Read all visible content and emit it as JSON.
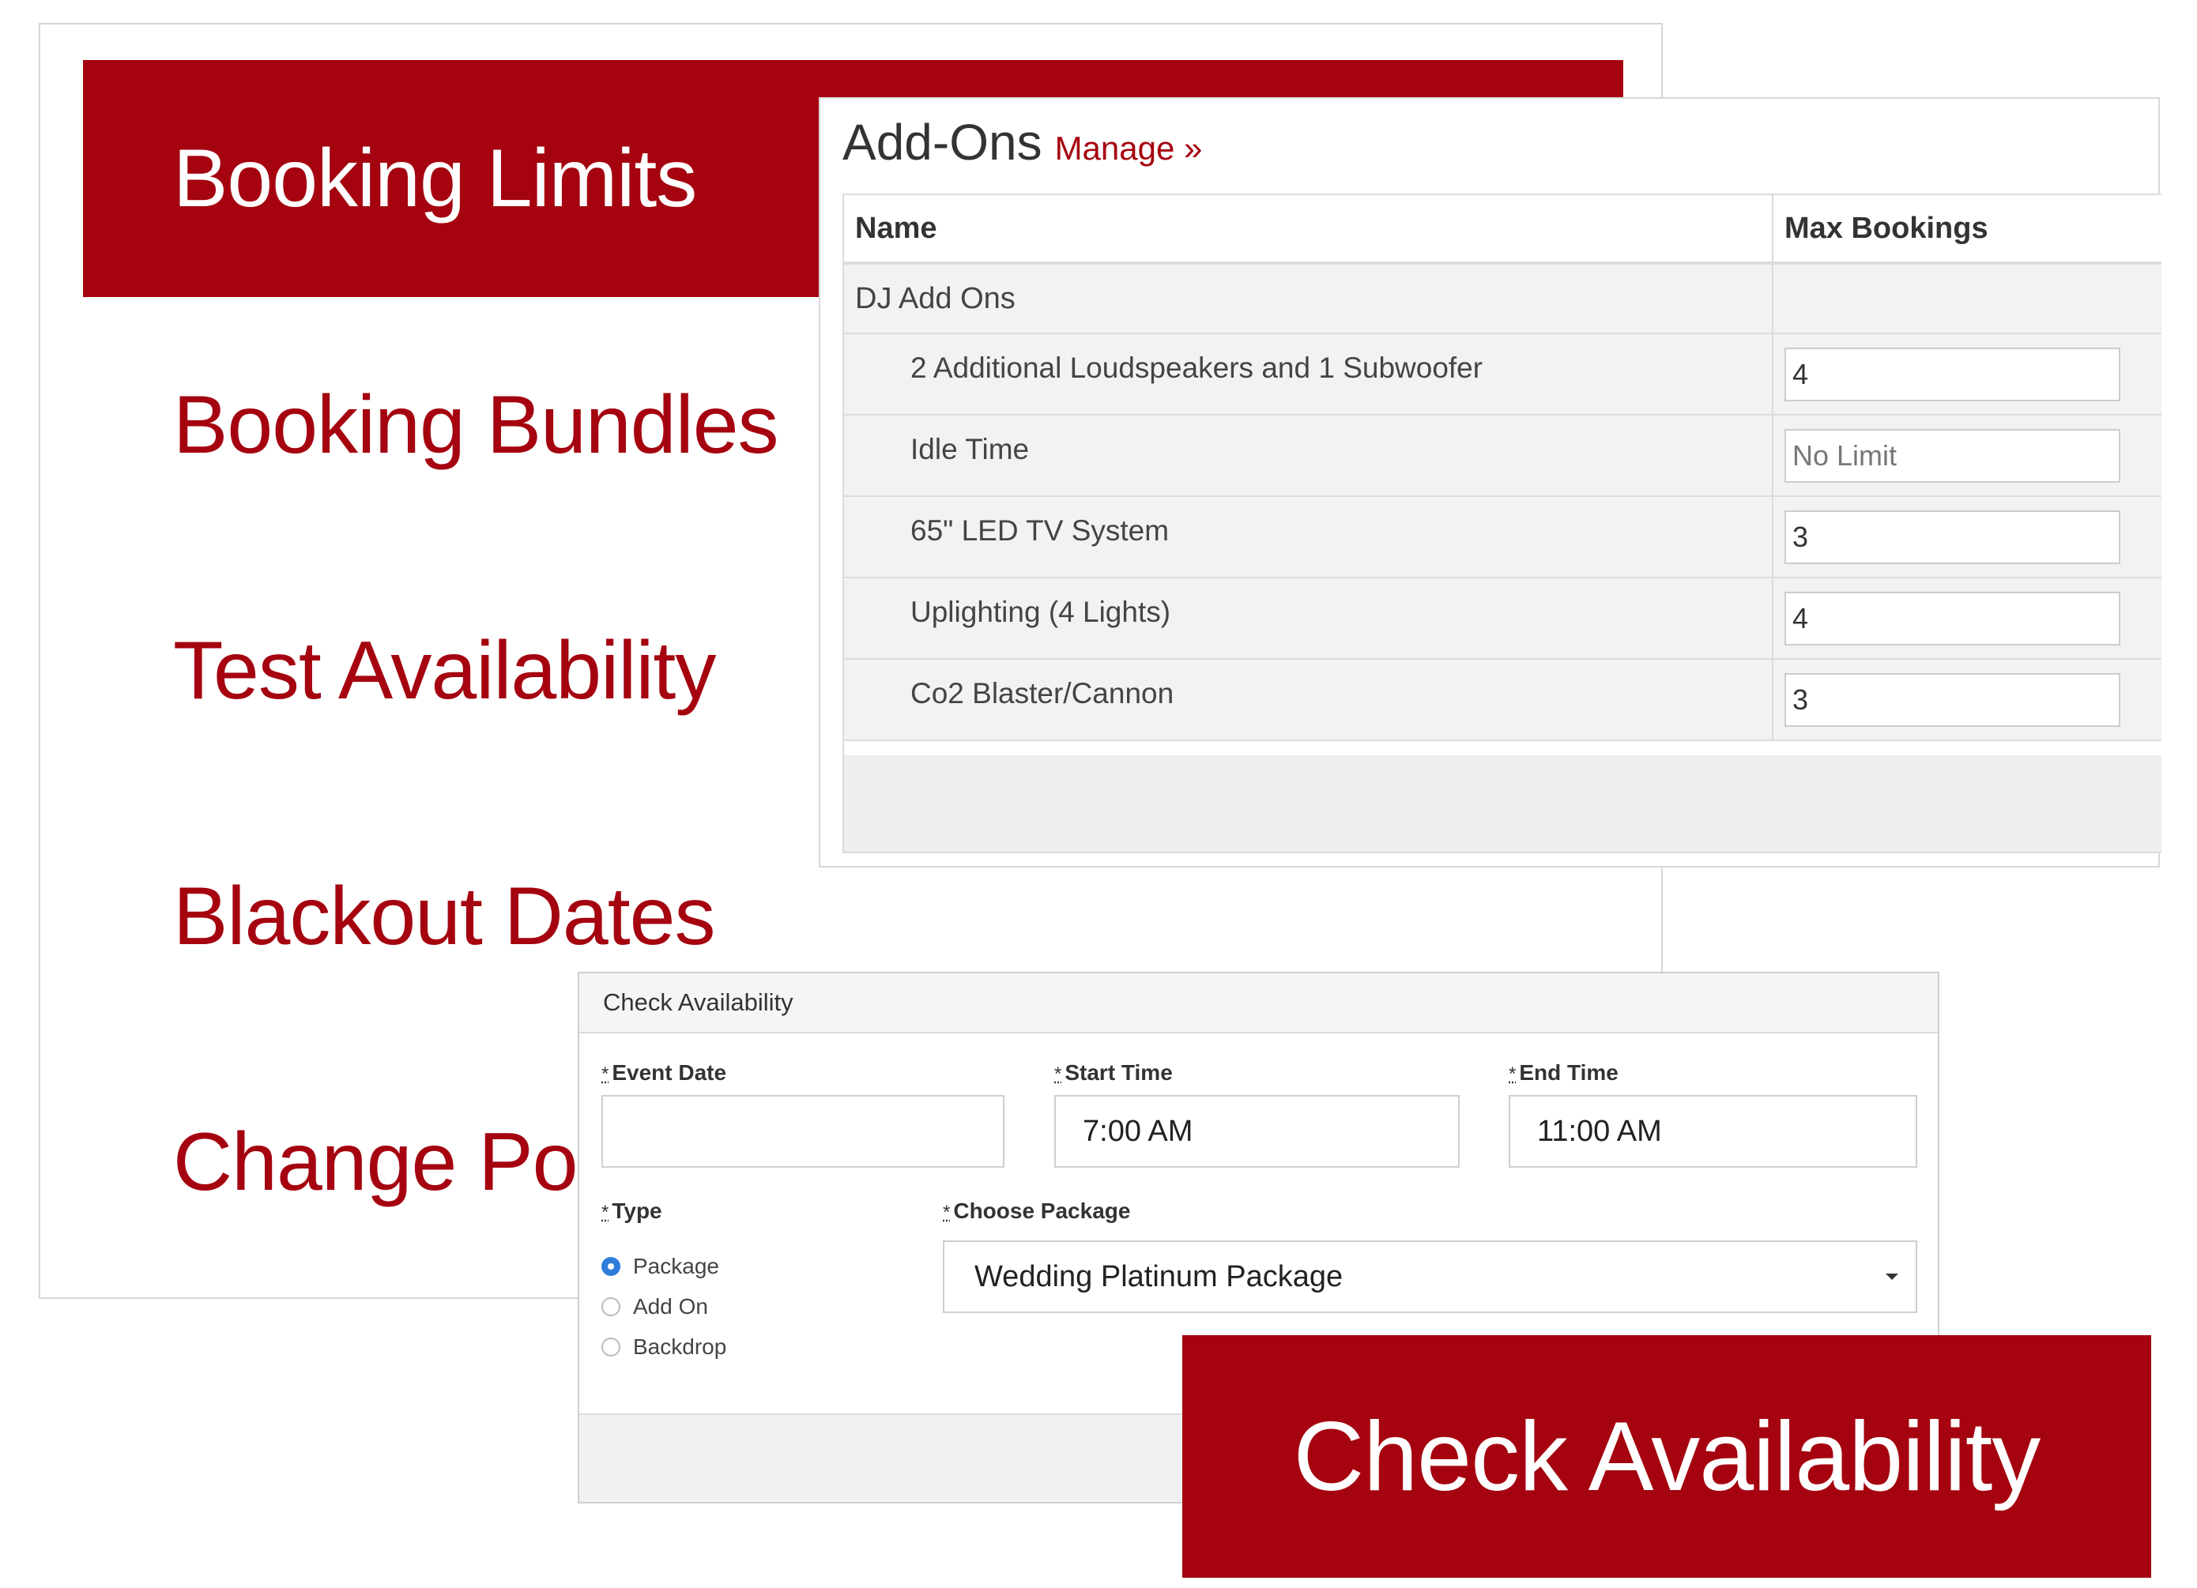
{
  "colors": {
    "brand": "#a5030f",
    "radio_selected": "#2f7ddb"
  },
  "menu": {
    "items": [
      {
        "label": "Booking Limits",
        "active": true
      },
      {
        "label": "Booking Bundles",
        "active": false
      },
      {
        "label": "Test Availability",
        "active": false
      },
      {
        "label": "Blackout Dates",
        "active": false
      },
      {
        "label": "Change Pol",
        "active": false
      }
    ]
  },
  "addons": {
    "title": "Add-Ons",
    "manage_link": "Manage »",
    "columns": [
      "Name",
      "Max Bookings"
    ],
    "group": "DJ Add Ons",
    "rows": [
      {
        "name": "2 Additional Loudspeakers and 1 Subwoofer",
        "max": "4",
        "placeholder": ""
      },
      {
        "name": "Idle Time",
        "max": "",
        "placeholder": "No Limit"
      },
      {
        "name": "65\" LED TV System",
        "max": "3",
        "placeholder": ""
      },
      {
        "name": "Uplighting (4 Lights)",
        "max": "4",
        "placeholder": ""
      },
      {
        "name": "Co2 Blaster/Cannon",
        "max": "3",
        "placeholder": ""
      }
    ]
  },
  "check": {
    "header": "Check Availability",
    "required_mark": "*",
    "event_date": {
      "label": "Event Date",
      "value": ""
    },
    "start_time": {
      "label": "Start Time",
      "value": "7:00 AM"
    },
    "end_time": {
      "label": "End Time",
      "value": "11:00 AM"
    },
    "type": {
      "label": "Type",
      "options": [
        "Package",
        "Add On",
        "Backdrop"
      ],
      "selected": "Package"
    },
    "package": {
      "label": "Choose Package",
      "value": "Wedding Platinum Package"
    }
  },
  "cta": {
    "label": "Check Availability"
  }
}
